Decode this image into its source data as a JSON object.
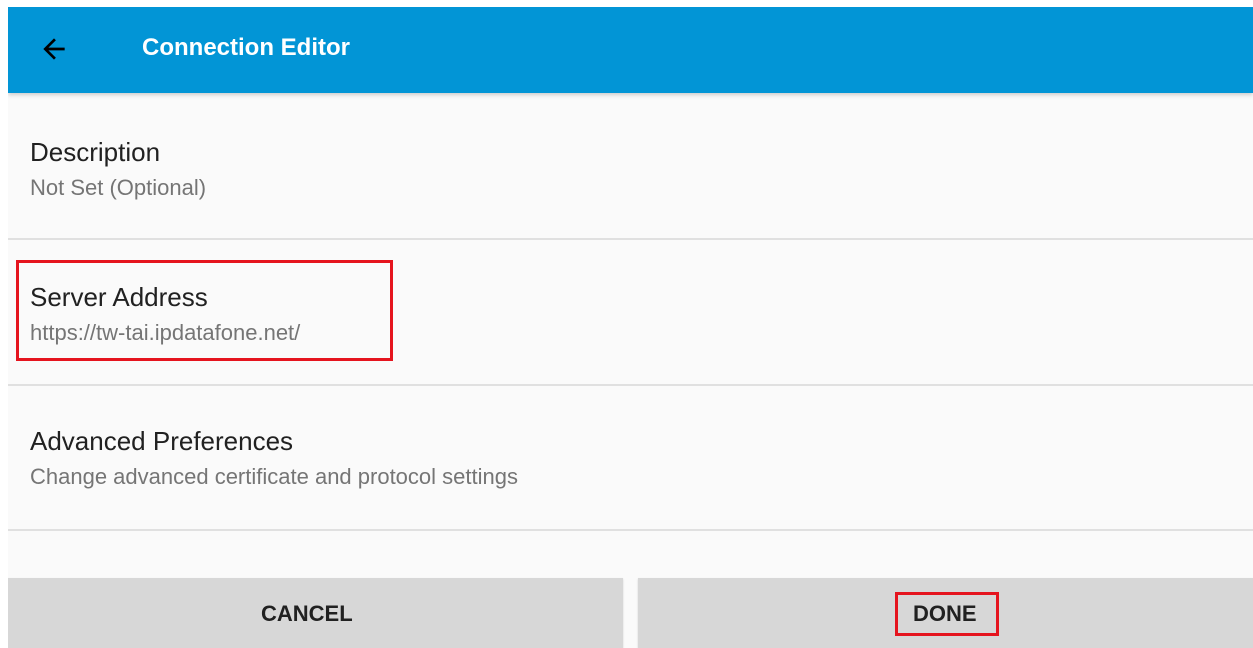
{
  "app_bar": {
    "title": "Connection Editor",
    "back_icon": "arrow-left-icon",
    "background_color": "#0295d6"
  },
  "preferences": [
    {
      "title": "Description",
      "summary": "Not Set (Optional)"
    },
    {
      "title": "Server Address",
      "summary": "https://tw-tai.ipdatafone.net/",
      "highlighted": true
    },
    {
      "title": "Advanced Preferences",
      "summary": "Change advanced certificate and protocol settings"
    }
  ],
  "buttons": {
    "cancel_label": "CANCEL",
    "done_label": "DONE",
    "done_highlighted": true
  },
  "colors": {
    "highlight": "#e5141e",
    "button_bg": "#d7d7d7",
    "divider": "#e0e0e0"
  }
}
